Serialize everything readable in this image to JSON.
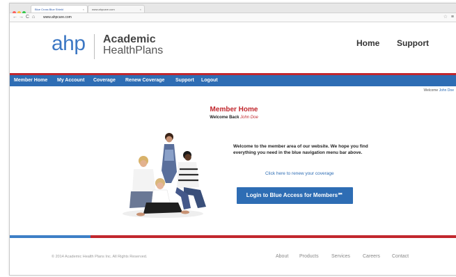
{
  "browser": {
    "tabs": [
      {
        "label": "Blue Cross Blue Shield",
        "active": true
      },
      {
        "label": "www.ahpcare.com",
        "active": false
      }
    ],
    "url": "www.ahpcare.com",
    "traffic_lights": [
      "#fc605c",
      "#fdbc40",
      "#34c84a"
    ]
  },
  "logo": {
    "mark": "ahp",
    "line1": "Academic",
    "line2": "HealthPlans"
  },
  "top_nav": {
    "home": "Home",
    "support": "Support"
  },
  "main_nav": [
    "Member Home",
    "My Account",
    "Coverage",
    "Renew Coverage",
    "Support",
    "Logout"
  ],
  "welcome_line": {
    "prefix": "Welcome",
    "name": "John Doe"
  },
  "content": {
    "title": "Member Home",
    "welcome_back_prefix": "Welcome Back",
    "welcome_back_name": "John Doe",
    "intro": "Welcome to the member area of our website. We hope you find everything you need in the blue navigation menu bar above.",
    "renew_link": "Click here to renew your coverage",
    "login_button": "Login to Blue Access for Members℠"
  },
  "footer": {
    "copyright": "© 2014 Academic Health Plans Inc. All Rights Reserved.",
    "links": [
      "About",
      "Products",
      "Services",
      "Careers",
      "Contact"
    ]
  },
  "colors": {
    "brand_blue": "#2e6db4",
    "accent_red": "#c1272d"
  }
}
